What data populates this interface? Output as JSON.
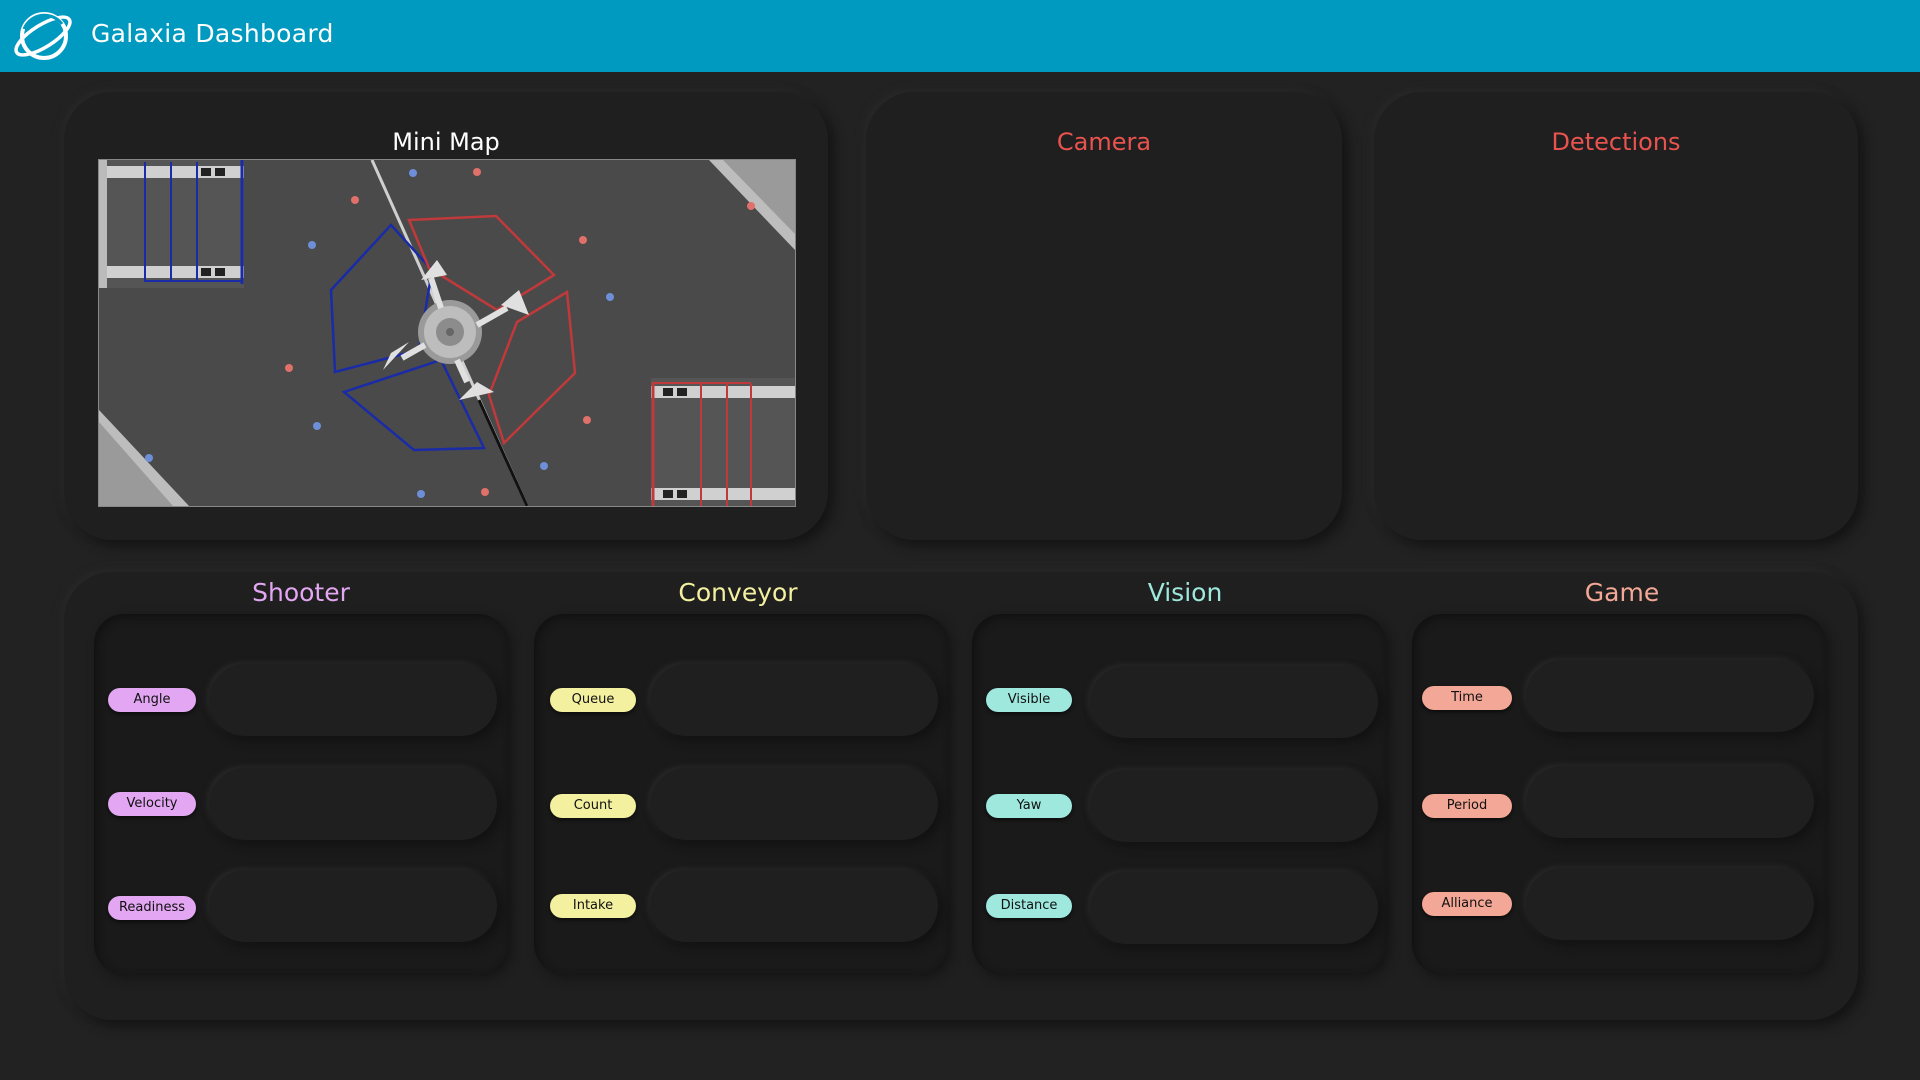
{
  "header": {
    "title": "Galaxia Dashboard",
    "logo_icon": "planet-ring-logo"
  },
  "cards": {
    "minimap": {
      "title": "Mini Map",
      "title_color": "#ffffff"
    },
    "camera": {
      "title": "Camera",
      "title_color": "#e9534f"
    },
    "detections": {
      "title": "Detections",
      "title_color": "#e9534f"
    }
  },
  "sections": {
    "shooter": {
      "title": "Shooter",
      "color": "#e2a6f2",
      "fields": [
        {
          "label": "Angle",
          "value": ""
        },
        {
          "label": "Velocity",
          "value": ""
        },
        {
          "label": "Readiness",
          "value": ""
        }
      ]
    },
    "conveyor": {
      "title": "Conveyor",
      "color": "#f3f0a0",
      "fields": [
        {
          "label": "Queue",
          "value": ""
        },
        {
          "label": "Count",
          "value": ""
        },
        {
          "label": "Intake",
          "value": ""
        }
      ]
    },
    "vision": {
      "title": "Vision",
      "color": "#9ee8dd",
      "fields": [
        {
          "label": "Visible",
          "value": ""
        },
        {
          "label": "Yaw",
          "value": ""
        },
        {
          "label": "Distance",
          "value": ""
        }
      ]
    },
    "game": {
      "title": "Game",
      "color": "#f3a796",
      "fields": [
        {
          "label": "Time",
          "value": ""
        },
        {
          "label": "Period",
          "value": ""
        },
        {
          "label": "Alliance",
          "value": ""
        }
      ]
    }
  },
  "colors": {
    "header_bg": "#0099bf",
    "background": "#222222",
    "blue_alliance": "#1a2ba8",
    "red_alliance": "#c0393b"
  }
}
